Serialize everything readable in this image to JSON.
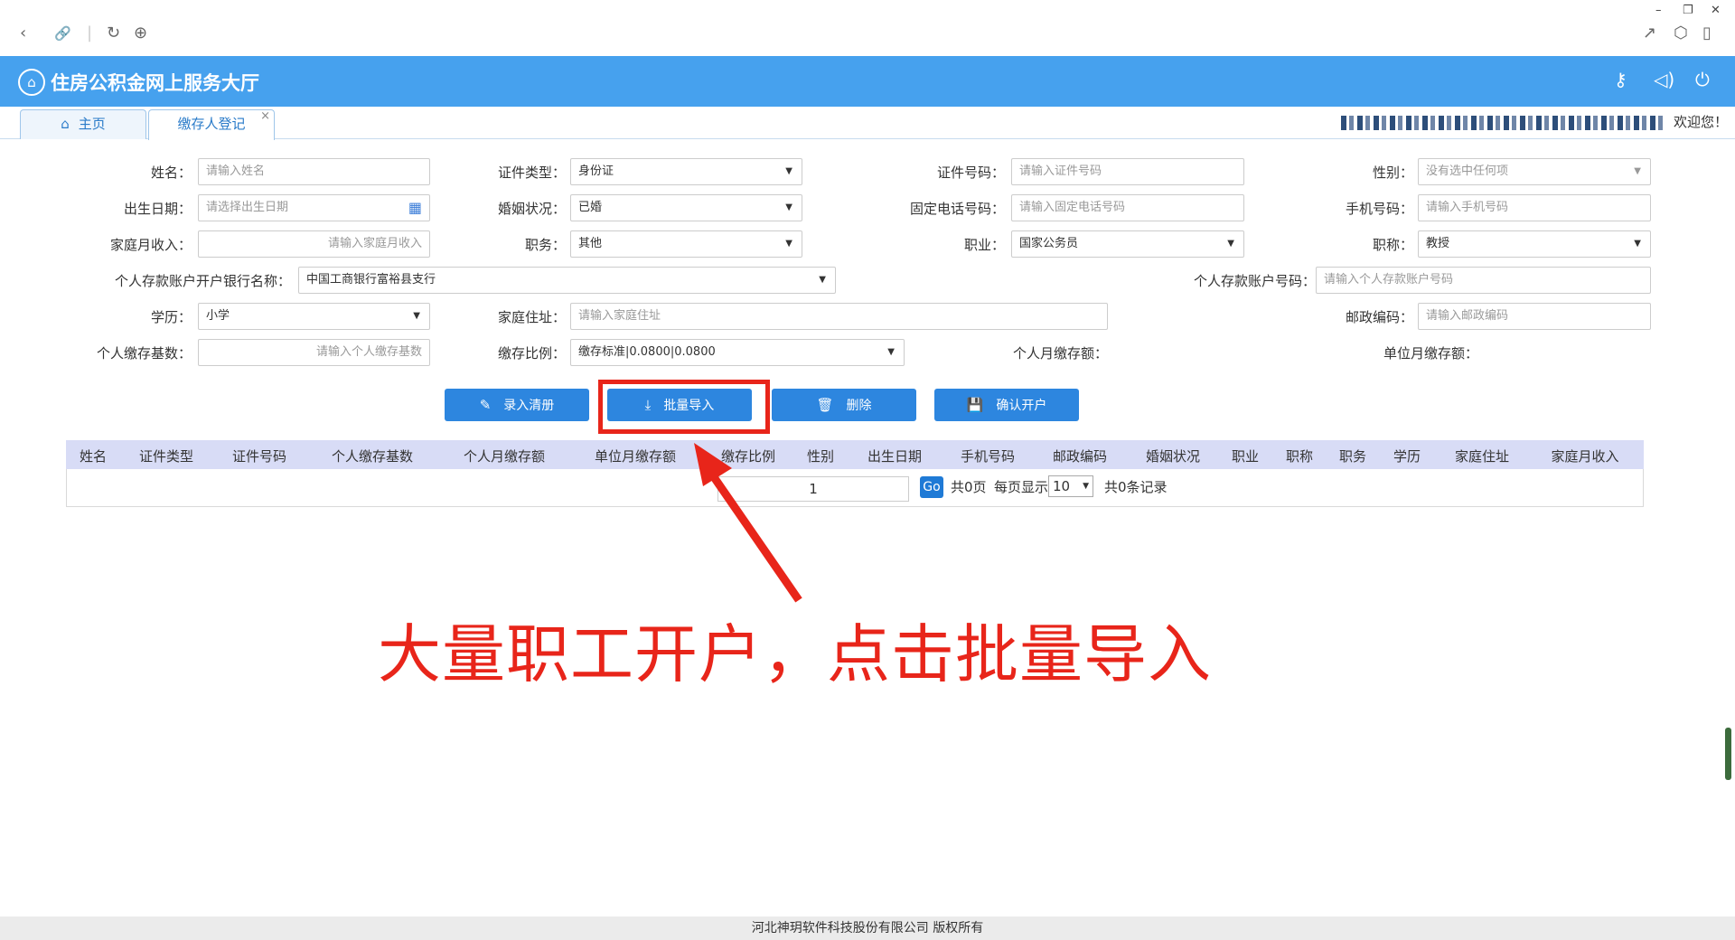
{
  "browser": {
    "icons": [
      "back-icon",
      "link-icon",
      "reload-icon",
      "globe-icon",
      "share-icon",
      "box-icon",
      "phone-icon"
    ],
    "window_controls": [
      "–",
      "❐",
      "✕"
    ]
  },
  "header": {
    "title": "住房公积金网上服务大厅",
    "colors": {
      "primary": "#46a1ee",
      "button": "#2d86df",
      "annotation": "#e8251a"
    }
  },
  "tabs": [
    {
      "label": "主页"
    },
    {
      "label": "缴存人登记",
      "close": "×"
    }
  ],
  "welcome": "欢迎您！",
  "form": {
    "name": {
      "label": "姓名：",
      "placeholder": "请输入姓名"
    },
    "id_type": {
      "label": "证件类型：",
      "value": "身份证"
    },
    "id_number": {
      "label": "证件号码：",
      "placeholder": "请输入证件号码"
    },
    "gender": {
      "label": "性别：",
      "value": "没有选中任何项"
    },
    "birth_date": {
      "label": "出生日期：",
      "placeholder": "请选择出生日期"
    },
    "marital": {
      "label": "婚姻状况：",
      "value": "已婚"
    },
    "landline": {
      "label": "固定电话号码：",
      "placeholder": "请输入固定电话号码"
    },
    "mobile": {
      "label": "手机号码：",
      "placeholder": "请输入手机号码"
    },
    "family_income": {
      "label": "家庭月收入：",
      "placeholder": "请输入家庭月收入"
    },
    "duty": {
      "label": "职务：",
      "value": "其他"
    },
    "occupation": {
      "label": "职业：",
      "value": "国家公务员"
    },
    "title": {
      "label": "职称：",
      "value": "教授"
    },
    "bank_name": {
      "label": "个人存款账户开户银行名称：",
      "value": "中国工商银行富裕县支行"
    },
    "account_no": {
      "label": "个人存款账户号码：",
      "placeholder": "请输入个人存款账户号码"
    },
    "education": {
      "label": "学历：",
      "value": "小学"
    },
    "address": {
      "label": "家庭住址：",
      "placeholder": "请输入家庭住址"
    },
    "postcode": {
      "label": "邮政编码：",
      "placeholder": "请输入邮政编码"
    },
    "base": {
      "label": "个人缴存基数：",
      "placeholder": "请输入个人缴存基数"
    },
    "ratio": {
      "label": "缴存比例：",
      "value": "缴存标准|0.0800|0.0800"
    },
    "personal_monthly": {
      "label": "个人月缴存额："
    },
    "unit_monthly": {
      "label": "单位月缴存额："
    }
  },
  "buttons": {
    "enter_list": "录入清册",
    "batch_import": "批量导入",
    "delete": "删除",
    "confirm_open": "确认开户"
  },
  "table": {
    "columns": [
      "姓名",
      "证件类型",
      "证件号码",
      "个人缴存基数",
      "个人月缴存额",
      "单位月缴存额",
      "缴存比例",
      "性别",
      "出生日期",
      "手机号码",
      "邮政编码",
      "婚姻状况",
      "职业",
      "职称",
      "职务",
      "学历",
      "家庭住址",
      "家庭月收入"
    ],
    "rows": []
  },
  "pager": {
    "page": "1",
    "go": "Go",
    "total_pages": "共0页",
    "per_page_label": "每页显示",
    "per_page": "10",
    "total_records": "共0条记录"
  },
  "annotation": "大量职工开户，点击批量导入",
  "footer": "河北神玥软件科技股份有限公司 版权所有"
}
